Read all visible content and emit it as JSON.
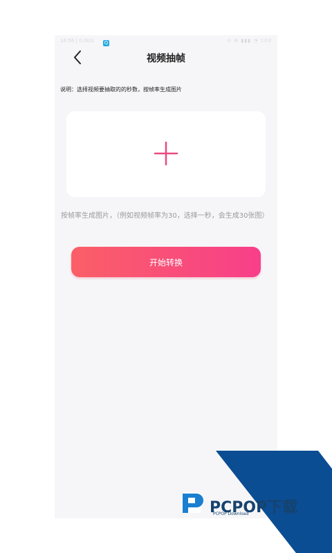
{
  "status_bar": {
    "left_text": "16:56 | 0.0K/s",
    "app_icon_glyph": "Q",
    "right_text": "⊙ ⋒ ▮▮▮ ◔ 100"
  },
  "header": {
    "title": "视频抽帧",
    "back_icon": "chevron-left-icon"
  },
  "notice": {
    "text": "说明：选择视频要抽取的的秒数，按帧率生成图片"
  },
  "upload": {
    "icon": "plus-icon",
    "accent_color": "#e84a7f"
  },
  "hint": {
    "text": "按帧率生成图片，（例如视频帧率为30，选择一秒，会生成30张图）"
  },
  "actions": {
    "start_label": "开始转换"
  },
  "watermark": {
    "brand": "PCPOP下载",
    "subtitle": "PCPOP Download"
  },
  "colors": {
    "background": "#f6f6f8",
    "button_gradient_start": "#fb5f67",
    "button_gradient_end": "#f73f8a",
    "watermark_blue": "#0b4d92"
  }
}
